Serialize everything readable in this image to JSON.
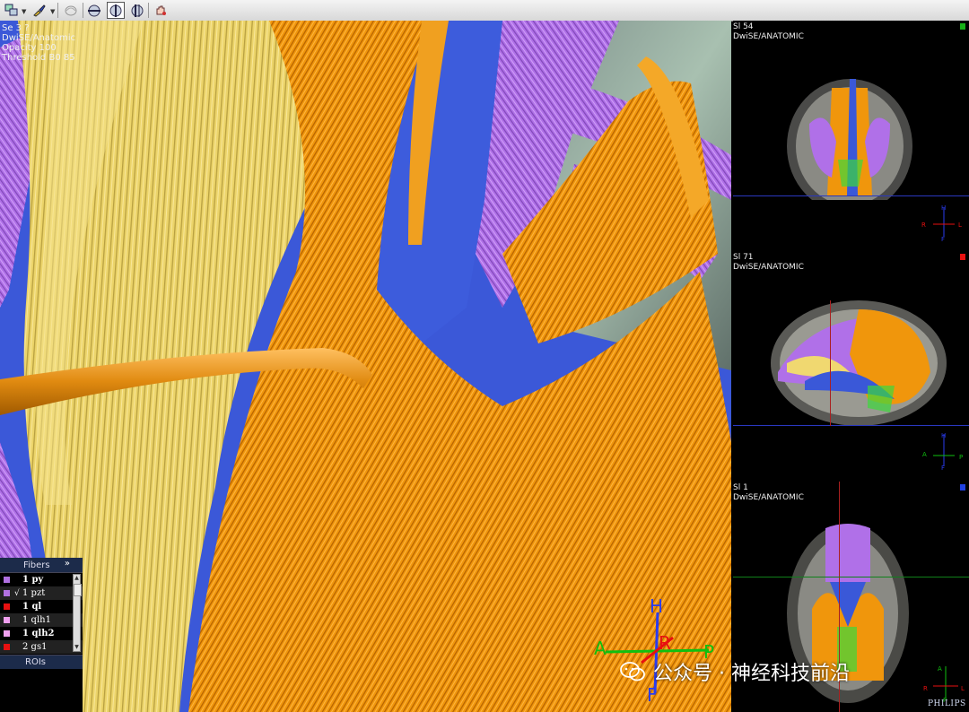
{
  "toolbar": {
    "tools": [
      {
        "name": "layout-tool"
      },
      {
        "name": "color-brush-tool"
      },
      {
        "name": "fiber-select-tool"
      },
      {
        "name": "clip-plane-tool"
      },
      {
        "name": "sagittal-view-tool",
        "active": true
      },
      {
        "name": "coronal-view-tool"
      },
      {
        "name": "pan-tool"
      }
    ]
  },
  "viewport_3d": {
    "series": "Se 3 ?",
    "protocol": "DwiSE/Anatomic",
    "opacity": "Opacity  100",
    "threshold": "Threshold B0  85",
    "orientation": {
      "top": "H",
      "bottom": "F",
      "left": "A",
      "right": "P",
      "center": "R"
    }
  },
  "fibers_panel": {
    "title": "Fibers",
    "expand_label": "»",
    "items": [
      {
        "label": "1 py",
        "color": "#b070e0",
        "checked": false,
        "bold": true
      },
      {
        "label": "1 pzt",
        "color": "#b070e0",
        "checked": true,
        "bold": false
      },
      {
        "label": "1 ql",
        "color": "#e81010",
        "checked": false,
        "bold": true
      },
      {
        "label": "1 qlh1",
        "color": "#f0a0f0",
        "checked": false,
        "bold": false
      },
      {
        "label": "1 qlh2",
        "color": "#f0a0f0",
        "checked": false,
        "bold": true
      },
      {
        "label": "2 gs1",
        "color": "#e81010",
        "checked": false,
        "bold": false
      }
    ],
    "check_mark": "√",
    "rois_label": "ROIs"
  },
  "slices": [
    {
      "slice": "Sl 54",
      "protocol": "DwiSE/ANATOMIC",
      "marker_color": "#18b018",
      "orient": {
        "h": "H",
        "r": "R",
        "l": "L",
        "f": "F"
      }
    },
    {
      "slice": "Sl 71",
      "protocol": "DwiSE/ANATOMIC",
      "marker_color": "#e81010",
      "orient": {
        "h": "H",
        "a": "A",
        "p": "P",
        "f": "F"
      }
    },
    {
      "slice": "Sl 1",
      "protocol": "DwiSE/ANATOMIC",
      "marker_color": "#2040e0",
      "orient": {
        "a": "A",
        "r": "R",
        "l": "L",
        "p": "P"
      }
    }
  ],
  "watermark": {
    "text": "公众号 · 神经科技前沿",
    "icon": "wechat-icon"
  },
  "vendor_logo": "PHILIPS",
  "colors": {
    "yellow_tract": "#f0d870",
    "orange_tract": "#f0980a",
    "violet_tract": "#b070e8",
    "blue_tract": "#3b58d8"
  }
}
